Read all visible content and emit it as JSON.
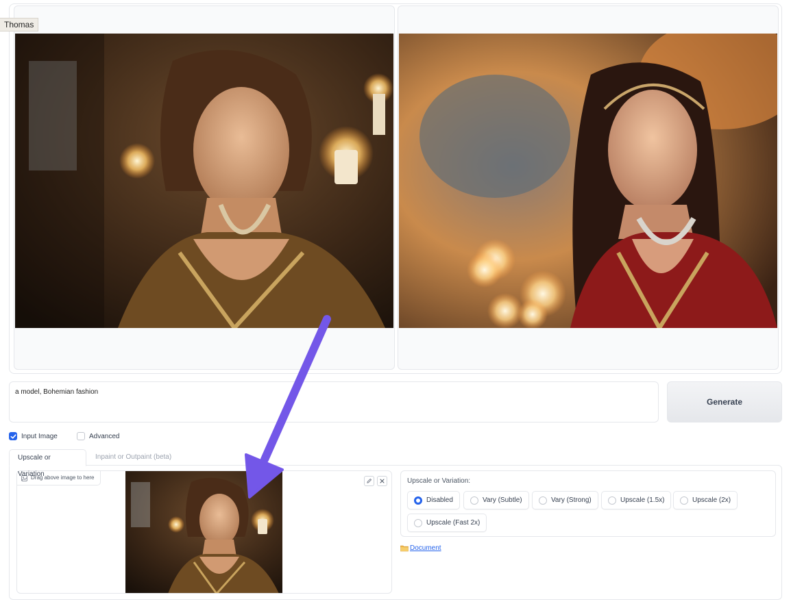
{
  "user_tag": "Thomas",
  "prompt": {
    "value": "a model, Bohemian fashion"
  },
  "generate_label": "Generate",
  "checkboxes": {
    "input_image": {
      "label": "Input Image",
      "checked": true
    },
    "advanced": {
      "label": "Advanced",
      "checked": false
    }
  },
  "tabs": [
    {
      "label": "Upscale or Variation",
      "active": true
    },
    {
      "label": "Inpaint or Outpaint (beta)",
      "active": false
    }
  ],
  "dropzone": {
    "label": "Drag above image to here"
  },
  "upscale": {
    "label": "Upscale or Variation:",
    "options": [
      {
        "label": "Disabled",
        "selected": true
      },
      {
        "label": "Vary (Subtle)",
        "selected": false
      },
      {
        "label": "Vary (Strong)",
        "selected": false
      },
      {
        "label": "Upscale (1.5x)",
        "selected": false
      },
      {
        "label": "Upscale (2x)",
        "selected": false
      },
      {
        "label": "Upscale (Fast 2x)",
        "selected": false
      }
    ]
  },
  "document_link": "Document",
  "colors": {
    "accent": "#2563eb",
    "arrow": "#7357e8",
    "border": "#e5e7eb"
  },
  "icons": {
    "dropzone": "image-icon",
    "edit": "pencil-icon",
    "clear": "close-icon",
    "document": "folder-icon"
  }
}
